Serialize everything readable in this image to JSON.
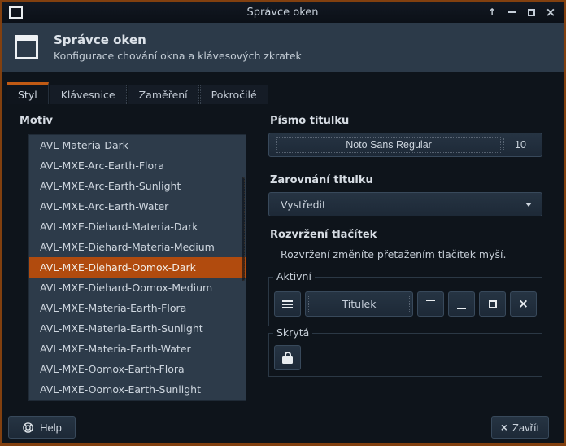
{
  "colors": {
    "window_border": "#82400f",
    "accent_selection": "#b14b0e",
    "tab_accent": "#c05a14",
    "titlebar_bg": "#0d131b",
    "header_bg": "#2c3a49",
    "page_bg": "#0e141b",
    "list_bg": "#2d3b4a",
    "button_border": "#38495b",
    "text": "#ced6df"
  },
  "titlebar": {
    "title": "Správce oken",
    "controls": [
      "shade",
      "minimize",
      "maximize",
      "close"
    ]
  },
  "header": {
    "title": "Správce oken",
    "subtitle": "Konfigurace chování okna a klávesových zkratek"
  },
  "tabs": [
    {
      "label": "Styl",
      "active": true
    },
    {
      "label": "Klávesnice",
      "active": false
    },
    {
      "label": "Zaměření",
      "active": false
    },
    {
      "label": "Pokročilé",
      "active": false
    }
  ],
  "theme": {
    "label": "Motiv",
    "selected_index": 6,
    "items": [
      "AVL-Materia-Dark",
      "AVL-MXE-Arc-Earth-Flora",
      "AVL-MXE-Arc-Earth-Sunlight",
      "AVL-MXE-Arc-Earth-Water",
      "AVL-MXE-Diehard-Materia-Dark",
      "AVL-MXE-Diehard-Materia-Medium",
      "AVL-MXE-Diehard-Oomox-Dark",
      "AVL-MXE-Diehard-Oomox-Medium",
      "AVL-MXE-Materia-Earth-Flora",
      "AVL-MXE-Materia-Earth-Sunlight",
      "AVL-MXE-Materia-Earth-Water",
      "AVL-MXE-Oomox-Earth-Flora",
      "AVL-MXE-Oomox-Earth-Sunlight"
    ]
  },
  "font": {
    "label": "Písmo titulku",
    "name": "Noto Sans Regular",
    "size": "10"
  },
  "alignment": {
    "label": "Zarovnání titulku",
    "value": "Vystředit"
  },
  "button_layout": {
    "label": "Rozvržení tlačítek",
    "hint": "Rozvržení změníte přetažením tlačítek myší.",
    "active_label": "Aktivní",
    "title_button": "Titulek",
    "hidden_label": "Skrytá"
  },
  "footer": {
    "help": "Help",
    "close": "Zavřít"
  },
  "icons": {
    "window-icon": "white window outline",
    "shade-icon": "↑",
    "minimize-icon": "−",
    "maximize-icon": "□",
    "close-icon": "×",
    "menu-icon": "≡",
    "lock-icon": "padlock",
    "help-icon": "lifebuoy",
    "dropdown-arrow-icon": "▾"
  }
}
